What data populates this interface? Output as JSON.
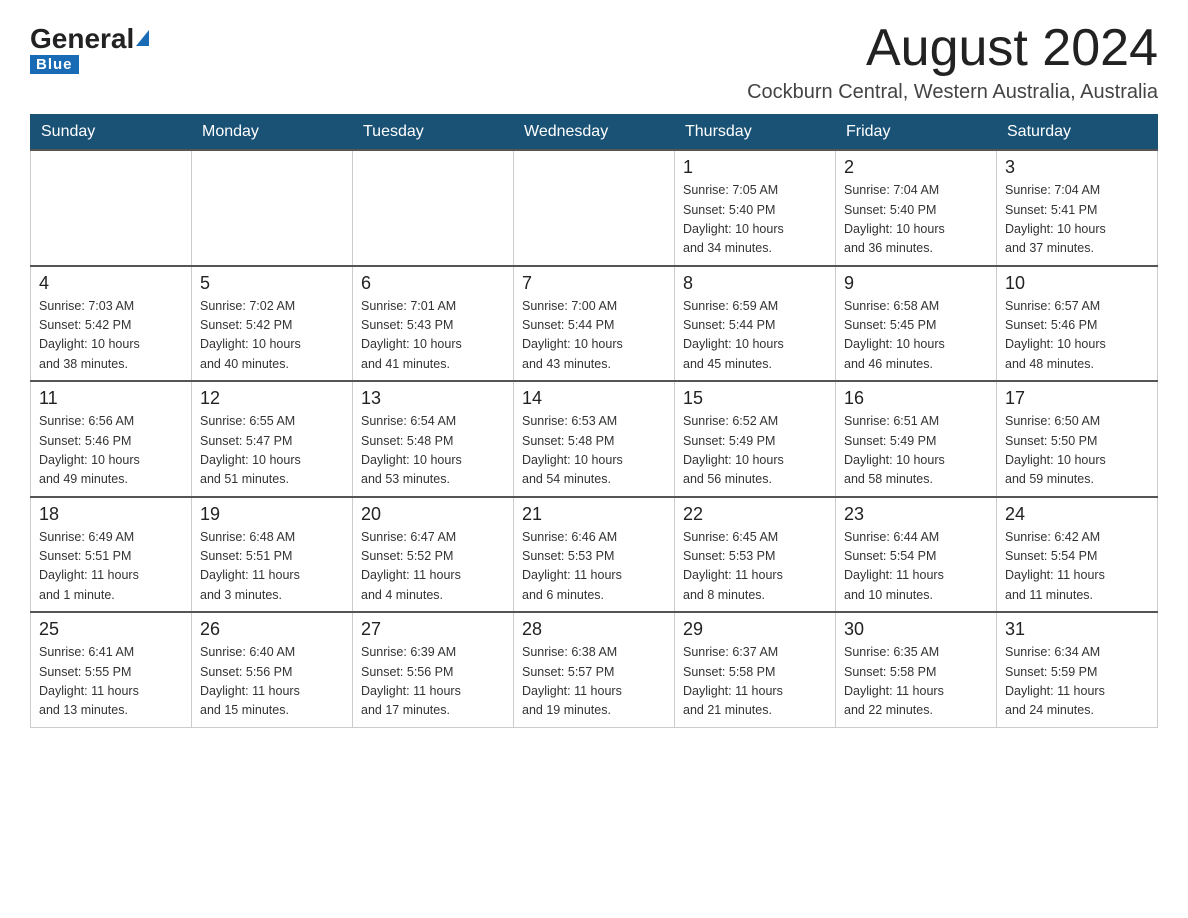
{
  "header": {
    "logo_general": "General",
    "logo_blue": "Blue",
    "month_title": "August 2024",
    "subtitle": "Cockburn Central, Western Australia, Australia"
  },
  "weekdays": [
    "Sunday",
    "Monday",
    "Tuesday",
    "Wednesday",
    "Thursday",
    "Friday",
    "Saturday"
  ],
  "weeks": [
    [
      {
        "day": "",
        "info": ""
      },
      {
        "day": "",
        "info": ""
      },
      {
        "day": "",
        "info": ""
      },
      {
        "day": "",
        "info": ""
      },
      {
        "day": "1",
        "info": "Sunrise: 7:05 AM\nSunset: 5:40 PM\nDaylight: 10 hours\nand 34 minutes."
      },
      {
        "day": "2",
        "info": "Sunrise: 7:04 AM\nSunset: 5:40 PM\nDaylight: 10 hours\nand 36 minutes."
      },
      {
        "day": "3",
        "info": "Sunrise: 7:04 AM\nSunset: 5:41 PM\nDaylight: 10 hours\nand 37 minutes."
      }
    ],
    [
      {
        "day": "4",
        "info": "Sunrise: 7:03 AM\nSunset: 5:42 PM\nDaylight: 10 hours\nand 38 minutes."
      },
      {
        "day": "5",
        "info": "Sunrise: 7:02 AM\nSunset: 5:42 PM\nDaylight: 10 hours\nand 40 minutes."
      },
      {
        "day": "6",
        "info": "Sunrise: 7:01 AM\nSunset: 5:43 PM\nDaylight: 10 hours\nand 41 minutes."
      },
      {
        "day": "7",
        "info": "Sunrise: 7:00 AM\nSunset: 5:44 PM\nDaylight: 10 hours\nand 43 minutes."
      },
      {
        "day": "8",
        "info": "Sunrise: 6:59 AM\nSunset: 5:44 PM\nDaylight: 10 hours\nand 45 minutes."
      },
      {
        "day": "9",
        "info": "Sunrise: 6:58 AM\nSunset: 5:45 PM\nDaylight: 10 hours\nand 46 minutes."
      },
      {
        "day": "10",
        "info": "Sunrise: 6:57 AM\nSunset: 5:46 PM\nDaylight: 10 hours\nand 48 minutes."
      }
    ],
    [
      {
        "day": "11",
        "info": "Sunrise: 6:56 AM\nSunset: 5:46 PM\nDaylight: 10 hours\nand 49 minutes."
      },
      {
        "day": "12",
        "info": "Sunrise: 6:55 AM\nSunset: 5:47 PM\nDaylight: 10 hours\nand 51 minutes."
      },
      {
        "day": "13",
        "info": "Sunrise: 6:54 AM\nSunset: 5:48 PM\nDaylight: 10 hours\nand 53 minutes."
      },
      {
        "day": "14",
        "info": "Sunrise: 6:53 AM\nSunset: 5:48 PM\nDaylight: 10 hours\nand 54 minutes."
      },
      {
        "day": "15",
        "info": "Sunrise: 6:52 AM\nSunset: 5:49 PM\nDaylight: 10 hours\nand 56 minutes."
      },
      {
        "day": "16",
        "info": "Sunrise: 6:51 AM\nSunset: 5:49 PM\nDaylight: 10 hours\nand 58 minutes."
      },
      {
        "day": "17",
        "info": "Sunrise: 6:50 AM\nSunset: 5:50 PM\nDaylight: 10 hours\nand 59 minutes."
      }
    ],
    [
      {
        "day": "18",
        "info": "Sunrise: 6:49 AM\nSunset: 5:51 PM\nDaylight: 11 hours\nand 1 minute."
      },
      {
        "day": "19",
        "info": "Sunrise: 6:48 AM\nSunset: 5:51 PM\nDaylight: 11 hours\nand 3 minutes."
      },
      {
        "day": "20",
        "info": "Sunrise: 6:47 AM\nSunset: 5:52 PM\nDaylight: 11 hours\nand 4 minutes."
      },
      {
        "day": "21",
        "info": "Sunrise: 6:46 AM\nSunset: 5:53 PM\nDaylight: 11 hours\nand 6 minutes."
      },
      {
        "day": "22",
        "info": "Sunrise: 6:45 AM\nSunset: 5:53 PM\nDaylight: 11 hours\nand 8 minutes."
      },
      {
        "day": "23",
        "info": "Sunrise: 6:44 AM\nSunset: 5:54 PM\nDaylight: 11 hours\nand 10 minutes."
      },
      {
        "day": "24",
        "info": "Sunrise: 6:42 AM\nSunset: 5:54 PM\nDaylight: 11 hours\nand 11 minutes."
      }
    ],
    [
      {
        "day": "25",
        "info": "Sunrise: 6:41 AM\nSunset: 5:55 PM\nDaylight: 11 hours\nand 13 minutes."
      },
      {
        "day": "26",
        "info": "Sunrise: 6:40 AM\nSunset: 5:56 PM\nDaylight: 11 hours\nand 15 minutes."
      },
      {
        "day": "27",
        "info": "Sunrise: 6:39 AM\nSunset: 5:56 PM\nDaylight: 11 hours\nand 17 minutes."
      },
      {
        "day": "28",
        "info": "Sunrise: 6:38 AM\nSunset: 5:57 PM\nDaylight: 11 hours\nand 19 minutes."
      },
      {
        "day": "29",
        "info": "Sunrise: 6:37 AM\nSunset: 5:58 PM\nDaylight: 11 hours\nand 21 minutes."
      },
      {
        "day": "30",
        "info": "Sunrise: 6:35 AM\nSunset: 5:58 PM\nDaylight: 11 hours\nand 22 minutes."
      },
      {
        "day": "31",
        "info": "Sunrise: 6:34 AM\nSunset: 5:59 PM\nDaylight: 11 hours\nand 24 minutes."
      }
    ]
  ]
}
